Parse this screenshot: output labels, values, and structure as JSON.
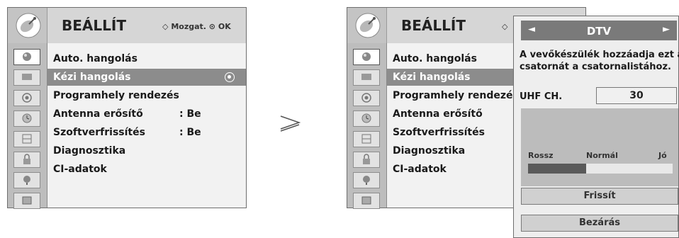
{
  "left_panel": {
    "title": "BEÁLLÍT",
    "hint_nav_glyph": "◇",
    "hint_move": "Mozgat.",
    "hint_ok_glyph": "⊙",
    "hint_ok": "OK",
    "menu": [
      {
        "label": "Auto. hangolás",
        "value": ""
      },
      {
        "label": "Kézi hangolás",
        "value": "",
        "selected": true
      },
      {
        "label": "Programhely rendezés",
        "value": ""
      },
      {
        "label": "Antenna erősítő",
        "value": ": Be"
      },
      {
        "label": "Szoftverfrissítés",
        "value": ": Be"
      },
      {
        "label": "Diagnosztika",
        "value": ""
      },
      {
        "label": "CI-adatok",
        "value": ""
      }
    ]
  },
  "right_panel": {
    "title": "BEÁLLÍT",
    "hint_nav_glyph": "◇",
    "menu": [
      {
        "label": "Auto. hangolás"
      },
      {
        "label": "Kézi hangolás",
        "selected": true
      },
      {
        "label": "Programhely rendezés"
      },
      {
        "label": "Antenna erősítő"
      },
      {
        "label": "Szoftverfrissítés"
      },
      {
        "label": "Diagnosztika"
      },
      {
        "label": "CI-adatok"
      }
    ]
  },
  "arrow_glyph": "≥",
  "dialog": {
    "left_arrow": "◄",
    "title": "DTV",
    "right_arrow": "►",
    "message_line1": "A vevőkészülék hozzáadja ezt a",
    "message_line2": "csatornát a csatornalistához.",
    "uhf_label": "UHF CH.",
    "uhf_value": "30",
    "signal": {
      "bad": "Rossz",
      "normal": "Normál",
      "good": "Jó",
      "level": 0.4
    },
    "refresh_button": "Frissít",
    "close_button": "Bezárás"
  }
}
